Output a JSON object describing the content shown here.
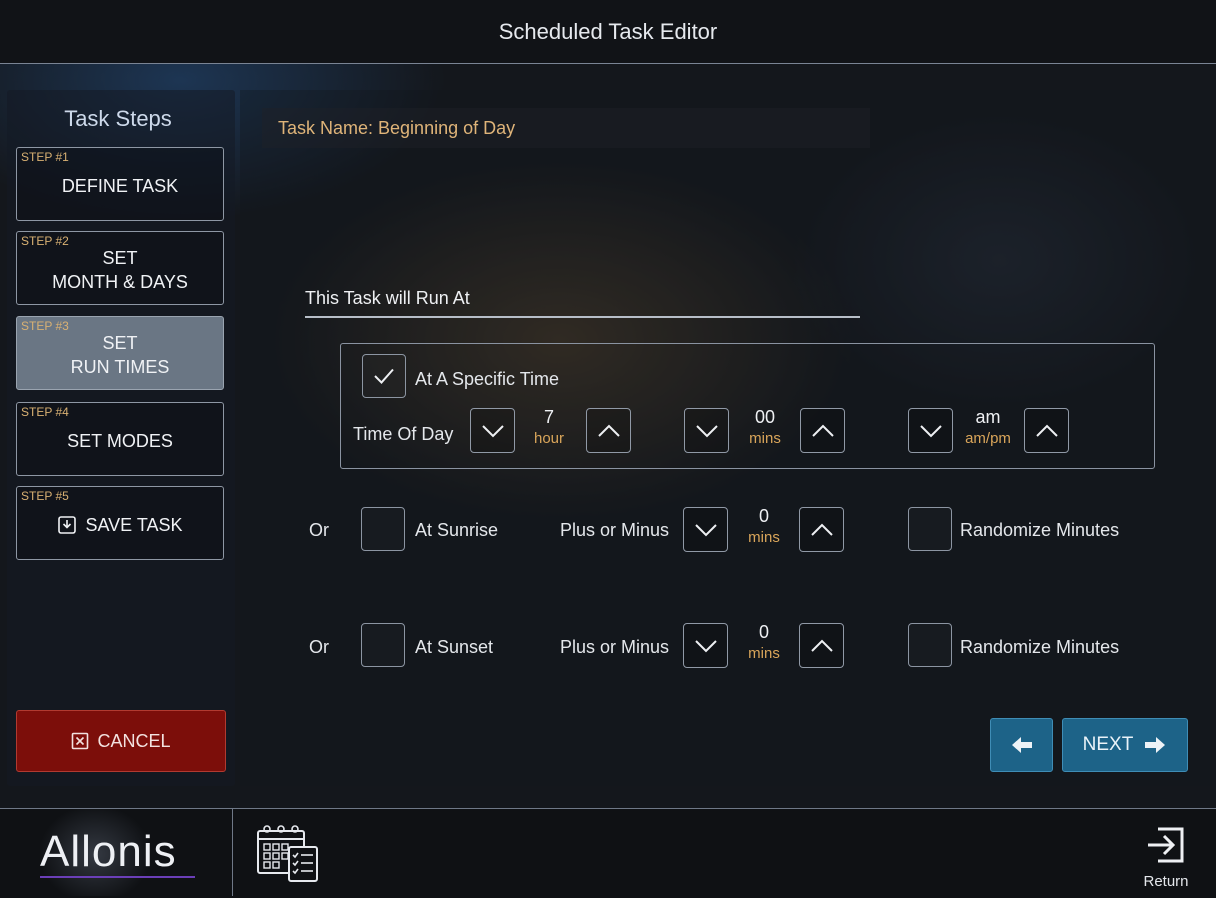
{
  "header": {
    "title": "Scheduled Task Editor"
  },
  "sidebar": {
    "heading": "Task Steps",
    "steps": [
      {
        "num": "STEP #1",
        "label": "DEFINE TASK"
      },
      {
        "num": "STEP #2",
        "label": "SET\nMONTH & DAYS"
      },
      {
        "num": "STEP #3",
        "label": "SET\nRUN TIMES",
        "active": true
      },
      {
        "num": "STEP #4",
        "label": "SET MODES"
      },
      {
        "num": "STEP #5",
        "label": "SAVE TASK",
        "icon": "save-icon"
      }
    ],
    "cancel_label": "CANCEL"
  },
  "main": {
    "task_name": "Task Name: Beginning of Day",
    "run_at_label": "This Task will Run At",
    "specific_time": {
      "label": "At A Specific Time",
      "checked": true,
      "time_of_day_label": "Time Of Day",
      "hour": {
        "value": "7",
        "unit": "hour"
      },
      "mins": {
        "value": "00",
        "unit": "mins"
      },
      "ampm": {
        "value": "am",
        "unit": "am/pm"
      }
    },
    "sunrise": {
      "or_label": "Or",
      "label": "At Sunrise",
      "checked": false,
      "offset_label": "Plus or Minus",
      "offset": {
        "value": "0",
        "unit": "mins"
      },
      "randomize_label": "Randomize Minutes",
      "randomize_checked": false
    },
    "sunset": {
      "or_label": "Or",
      "label": "At Sunset",
      "checked": false,
      "offset_label": "Plus or Minus",
      "offset": {
        "value": "0",
        "unit": "mins"
      },
      "randomize_label": "Randomize Minutes",
      "randomize_checked": false
    },
    "next_label": "NEXT"
  },
  "footer": {
    "logo_text": "Allonis",
    "return_label": "Return"
  },
  "colors": {
    "accent_blue": "#1d6388",
    "cancel_red": "#7c0e0a",
    "label_gold": "#d9a55a",
    "active_step": "#6a7684"
  }
}
